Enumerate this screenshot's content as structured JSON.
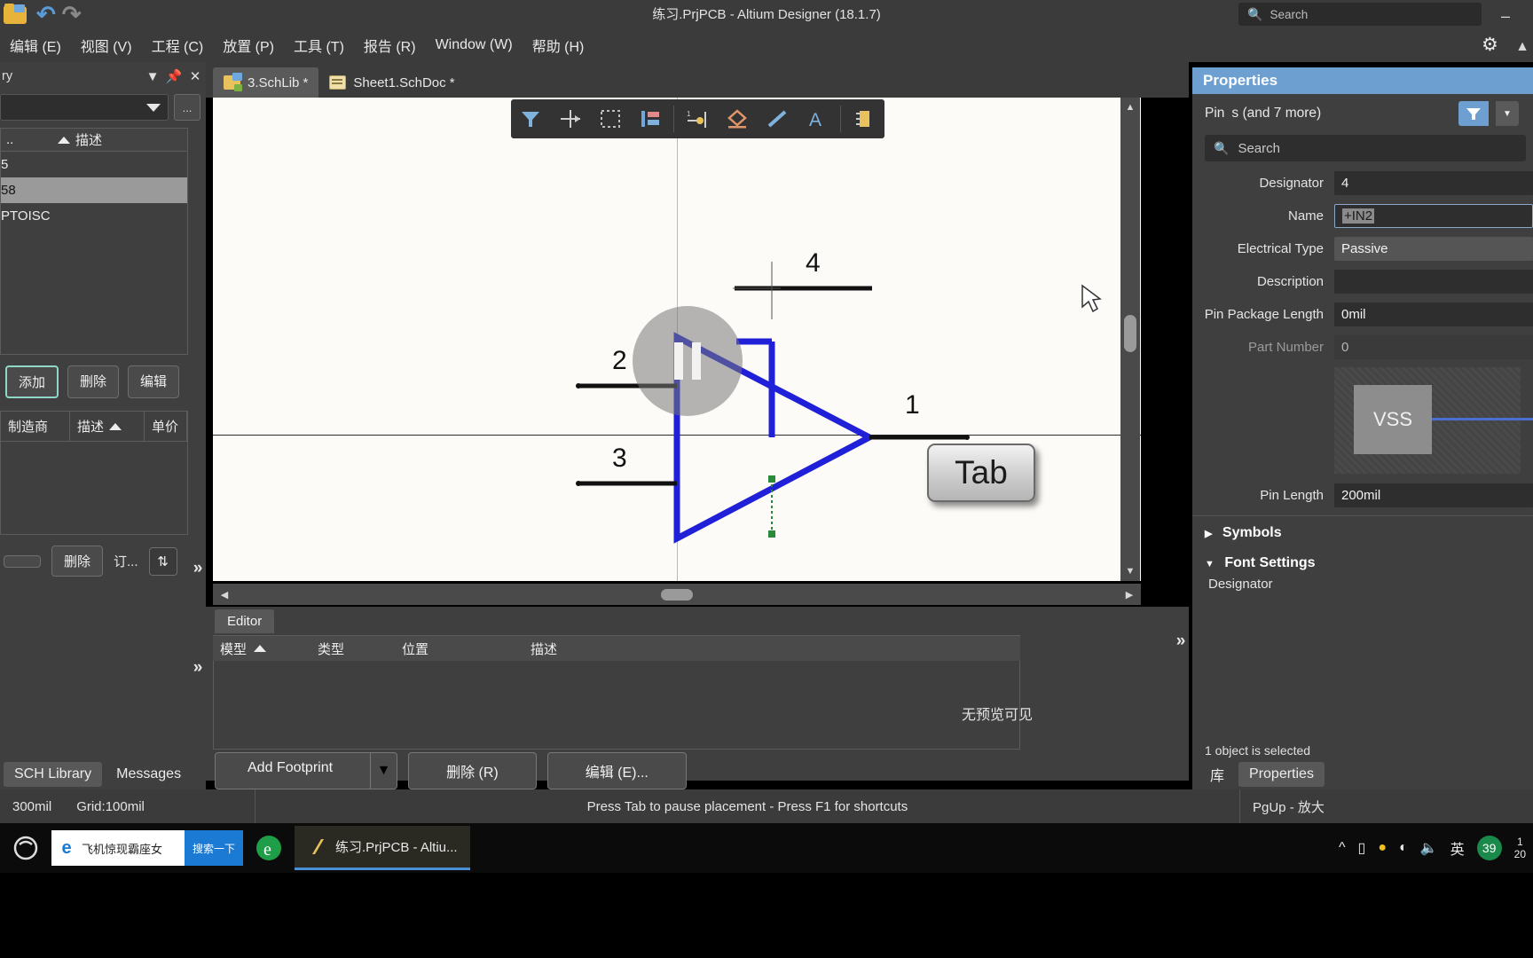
{
  "titlebar": {
    "window_title": "练习.PrjPCB - Altium Designer (18.1.7)",
    "search_placeholder": "Search",
    "minimize_label": "–",
    "quick_access": [
      "open-icon",
      "undo-icon",
      "redo-icon"
    ]
  },
  "menubar": {
    "items": [
      {
        "label": "编辑 (E)"
      },
      {
        "label": "视图 (V)"
      },
      {
        "label": "工程 (C)"
      },
      {
        "label": "放置 (P)"
      },
      {
        "label": "工具 (T)"
      },
      {
        "label": "报告 (R)"
      },
      {
        "label": "Window (W)"
      },
      {
        "label": "帮助 (H)"
      }
    ]
  },
  "left_panel": {
    "title": "ry",
    "combo_value": "",
    "dots_label": "...",
    "table1": {
      "columns": [
        "..",
        "描述"
      ],
      "rows": [
        "5",
        "58",
        "PTOISC"
      ],
      "selected_index": 1
    },
    "buttons": [
      "添加",
      "删除",
      "编辑"
    ],
    "table2": {
      "columns": [
        "制造商",
        "描述",
        "单价"
      ]
    },
    "buttons2": [
      "",
      "删除",
      "订..."
    ],
    "bottom_tabs": [
      "SCH Library",
      "Messages"
    ]
  },
  "tabs": [
    {
      "label": "3.SchLib *",
      "icon": "schlib-icon",
      "active": true
    },
    {
      "label": "Sheet1.SchDoc *",
      "icon": "schdoc-icon",
      "active": false
    }
  ],
  "editor_toolbar": {
    "buttons": [
      "filter-icon",
      "move-crosshair-icon",
      "select-area-icon",
      "align-icon",
      "place-pin-icon",
      "place-polygon-icon",
      "place-line-icon",
      "place-text-icon",
      "place-ic-icon"
    ]
  },
  "canvas": {
    "pin_numbers": [
      "4",
      "2",
      "1",
      "3"
    ],
    "tab_key_label": "Tab",
    "overlay": "pause-button",
    "colors": {
      "wire": "#2020d8",
      "pin": "#111111",
      "background": "#fdfbf7"
    }
  },
  "bottom_panel": {
    "tab": "Editor",
    "columns": [
      "模型",
      "类型",
      "位置",
      "描述"
    ],
    "preview_text": "无预览可见",
    "buttons": [
      {
        "label": "Add Footprint",
        "has_dropdown": true
      },
      {
        "label": "删除 (R)",
        "has_dropdown": false
      },
      {
        "label": "编辑 (E)...",
        "has_dropdown": false
      }
    ]
  },
  "properties": {
    "title": "Properties",
    "object_type": "Pin",
    "object_count": "s (and 7 more)",
    "search_placeholder": "Search",
    "fields": [
      {
        "label": "Designator",
        "value": "4",
        "state": "normal"
      },
      {
        "label": "Name",
        "value": "+IN2",
        "state": "selected"
      },
      {
        "label": "Electrical Type",
        "value": "Passive",
        "state": "light"
      },
      {
        "label": "Description",
        "value": "",
        "state": "normal"
      },
      {
        "label": "Pin Package Length",
        "value": "0mil",
        "state": "normal"
      },
      {
        "label": "Part Number",
        "value": "0",
        "state": "dim"
      }
    ],
    "preview_label": "VSS",
    "pin_length": {
      "label": "Pin Length",
      "value": "200mil"
    },
    "sections": [
      {
        "label": "Symbols",
        "expanded": false
      },
      {
        "label": "Font Settings",
        "expanded": true
      }
    ],
    "font_settings_row": "Designator",
    "status": "1 object is selected",
    "tabs": [
      {
        "label": "库",
        "active": false
      },
      {
        "label": "Properties",
        "active": true
      }
    ]
  },
  "statusbar": {
    "left": "300mil",
    "grid": "Grid:100mil",
    "hint": "Press Tab to pause placement - Press F1 for shortcuts",
    "right": "PgUp - 放大"
  },
  "taskbar": {
    "search_text": "飞机惊现霸座女",
    "search_button": "搜索一下",
    "task_label": "练习.PrjPCB - Altiu...",
    "tray": {
      "ime": "英",
      "badge": "39",
      "clock_line1": "1",
      "clock_line2": "20"
    }
  }
}
